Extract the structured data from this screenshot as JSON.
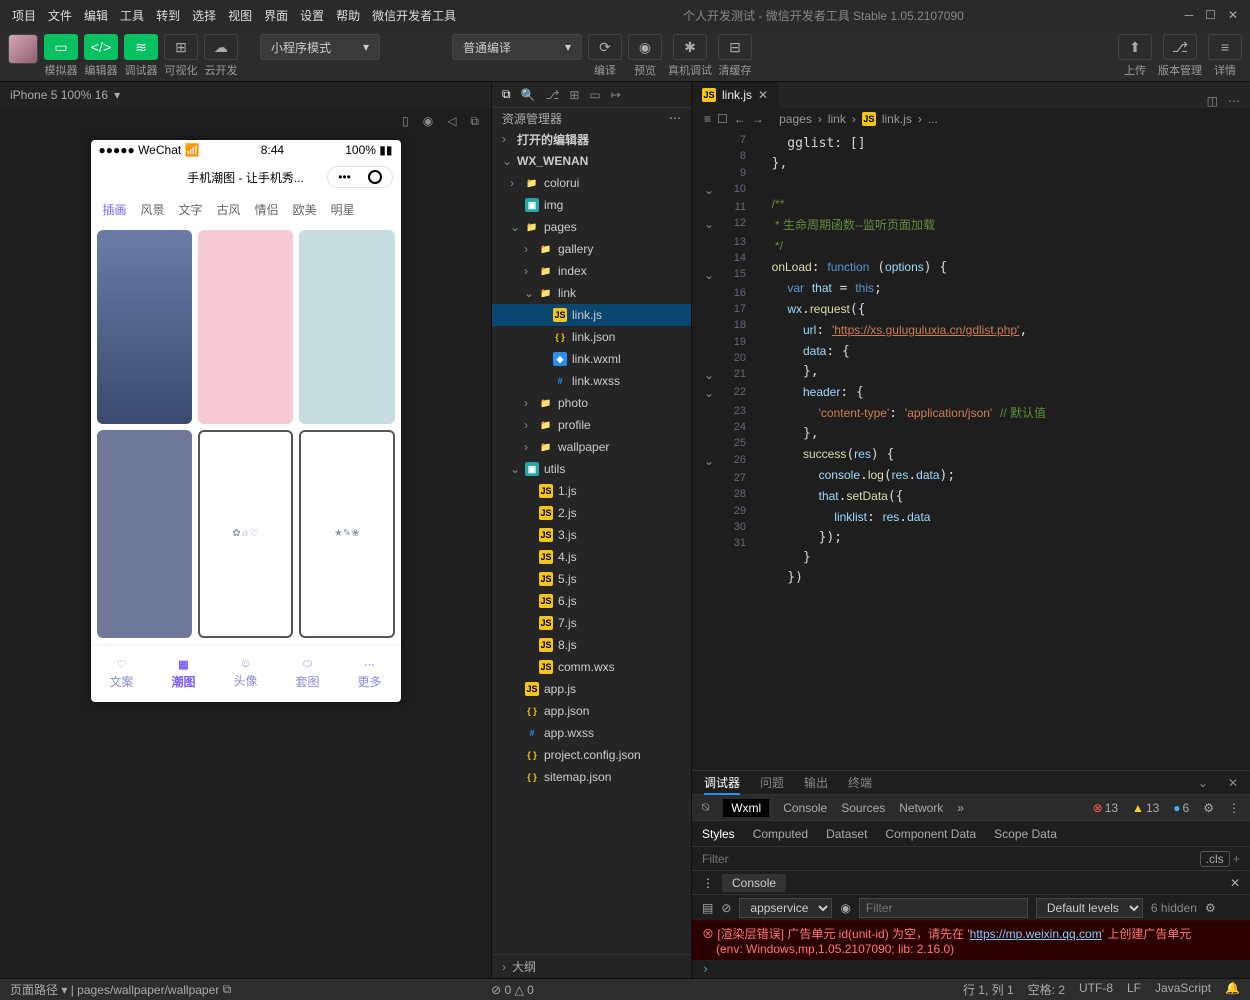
{
  "menu": [
    "项目",
    "文件",
    "编辑",
    "工具",
    "转到",
    "选择",
    "视图",
    "界面",
    "设置",
    "帮助",
    "微信开发者工具"
  ],
  "window_title": "个人开发测试 - 微信开发者工具 Stable 1.05.2107090",
  "toolbar": {
    "labels": [
      "模拟器",
      "编辑器",
      "调试器",
      "可视化",
      "云开发"
    ],
    "mode_dropdown": "小程序模式",
    "compile_dropdown": "普通编译",
    "right_labels": [
      "编译",
      "预览",
      "真机调试",
      "清缓存"
    ],
    "far_right": [
      "上传",
      "版本管理",
      "详情"
    ]
  },
  "simulator": {
    "device": "iPhone 5 100% 16",
    "status_carrier": "●●●●● WeChat",
    "status_time": "8:44",
    "status_batt": "100%",
    "page_title": "手机潮图 - 让手机秀...",
    "tabs": [
      "插画",
      "风景",
      "文字",
      "古风",
      "情侣",
      "欧美",
      "明星"
    ],
    "active_tab": 0,
    "nav": [
      "文案",
      "潮图",
      "头像",
      "套图",
      "更多"
    ],
    "nav_active": 1
  },
  "explorer": {
    "header": "资源管理器",
    "sections": [
      "打开的编辑器",
      "WX_WENAN"
    ],
    "tree": [
      {
        "d": 1,
        "t": "folder",
        "n": "colorui"
      },
      {
        "d": 1,
        "t": "img",
        "n": "img"
      },
      {
        "d": 1,
        "t": "folder",
        "n": "pages",
        "open": true
      },
      {
        "d": 2,
        "t": "folder",
        "n": "gallery"
      },
      {
        "d": 2,
        "t": "folder",
        "n": "index"
      },
      {
        "d": 2,
        "t": "folder",
        "n": "link",
        "open": true
      },
      {
        "d": 3,
        "t": "js",
        "n": "link.js",
        "sel": true
      },
      {
        "d": 3,
        "t": "json",
        "n": "link.json"
      },
      {
        "d": 3,
        "t": "wxml",
        "n": "link.wxml"
      },
      {
        "d": 3,
        "t": "wxss",
        "n": "link.wxss"
      },
      {
        "d": 2,
        "t": "folder",
        "n": "photo"
      },
      {
        "d": 2,
        "t": "folder",
        "n": "profile"
      },
      {
        "d": 2,
        "t": "folder",
        "n": "wallpaper"
      },
      {
        "d": 1,
        "t": "img",
        "n": "utils",
        "open": true
      },
      {
        "d": 2,
        "t": "js",
        "n": "1.js"
      },
      {
        "d": 2,
        "t": "js",
        "n": "2.js"
      },
      {
        "d": 2,
        "t": "js",
        "n": "3.js"
      },
      {
        "d": 2,
        "t": "js",
        "n": "4.js"
      },
      {
        "d": 2,
        "t": "js",
        "n": "5.js"
      },
      {
        "d": 2,
        "t": "js",
        "n": "6.js"
      },
      {
        "d": 2,
        "t": "js",
        "n": "7.js"
      },
      {
        "d": 2,
        "t": "js",
        "n": "8.js"
      },
      {
        "d": 2,
        "t": "js",
        "n": "comm.wxs"
      },
      {
        "d": 1,
        "t": "js",
        "n": "app.js"
      },
      {
        "d": 1,
        "t": "json",
        "n": "app.json"
      },
      {
        "d": 1,
        "t": "wxss",
        "n": "app.wxss"
      },
      {
        "d": 1,
        "t": "json",
        "n": "project.config.json"
      },
      {
        "d": 1,
        "t": "json",
        "n": "sitemap.json"
      }
    ],
    "outline": "大纲"
  },
  "editor": {
    "tab": "link.js",
    "breadcrumb": [
      "pages",
      "link",
      "link.js",
      "..."
    ],
    "gutter_start": 7,
    "gutter_end": 31,
    "code_comment1": "/**",
    "code_comment2": " * 生命周期函数--监听页面加载",
    "code_comment3": " */",
    "code_url": "'https://xs.guluguluxia.cn/gdlist.php'",
    "code_ct": "'content-type'",
    "code_app": "'application/json'",
    "code_tail": "// 默认值"
  },
  "debugger": {
    "tabs": [
      "调试器",
      "问题",
      "输出",
      "终端"
    ],
    "tooltabs": [
      "Wxml",
      "Console",
      "Sources",
      "Network"
    ],
    "err_count": "13",
    "warn_count": "13",
    "info_count": "6",
    "styles_tabs": [
      "Styles",
      "Computed",
      "Dataset",
      "Component Data",
      "Scope Data"
    ],
    "filter_placeholder": "Filter",
    "cls": ".cls",
    "console": {
      "label": "Console",
      "context": "appservice",
      "levels": "Default levels",
      "hidden": "6 hidden",
      "err1": "[渲染层错误] 广告单元 id(unit-id) 为空，请先在 '",
      "err_link": "https://mp.weixin.qq.com",
      "err1b": "' 上创建广告单元",
      "err2": "(env: Windows,mp,1.05.2107090; lib: 2.16.0)"
    }
  },
  "status": {
    "left_label": "页面路径",
    "path": "pages/wallpaper/wallpaper",
    "diag": "⊘ 0 △ 0",
    "rc": "行 1, 列 1",
    "spaces": "空格: 2",
    "enc": "UTF-8",
    "eol": "LF",
    "lang": "JavaScript"
  }
}
